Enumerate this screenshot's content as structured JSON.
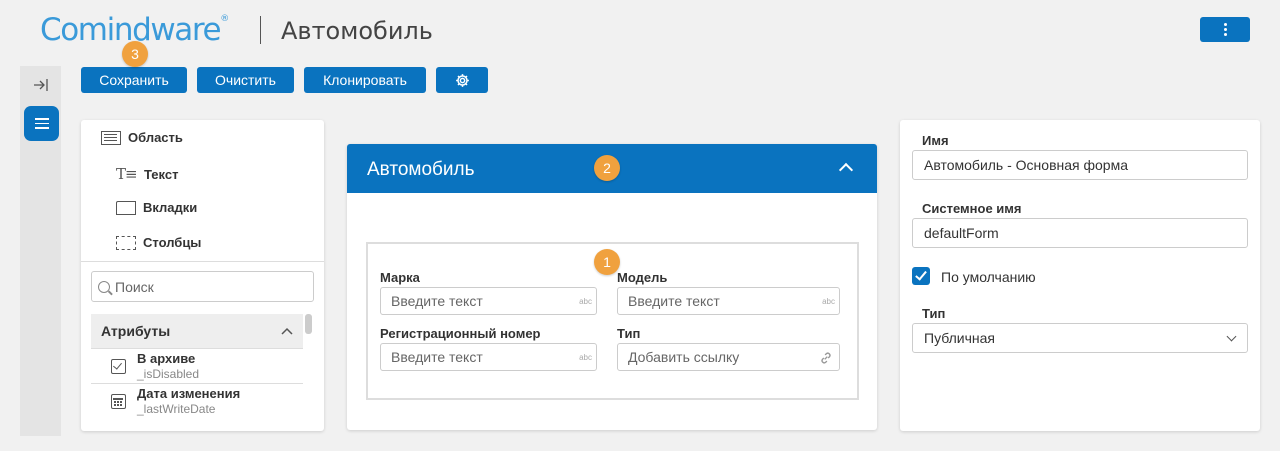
{
  "header": {
    "logo_main": "Comindware",
    "logo_trademark": "®",
    "page_title": "Автомобиль",
    "menu_icon": "more-vertical-icon"
  },
  "toolbar": {
    "save": "Сохранить",
    "clear": "Очистить",
    "clone": "Клонировать",
    "settings_icon": "gear-icon"
  },
  "badges": {
    "form_fields": "1",
    "form_header": "2",
    "save": "3"
  },
  "rail": {
    "collapse_icon": "collapse-right-icon",
    "menu_icon": "hamburger-icon"
  },
  "toolbox": {
    "items": [
      {
        "label": "Область",
        "icon": "area-icon"
      },
      {
        "label": "Текст",
        "icon": "text-icon"
      },
      {
        "label": "Вкладки",
        "icon": "tabs-icon"
      },
      {
        "label": "Столбцы",
        "icon": "columns-icon"
      }
    ],
    "search_placeholder": "Поиск",
    "attributes_header": "Атрибуты",
    "attributes": [
      {
        "name": "В архиве",
        "system_name": "_isDisabled",
        "icon": "checkbox-icon"
      },
      {
        "name": "Дата изменения",
        "system_name": "_lastWriteDate",
        "icon": "calendar-icon"
      }
    ]
  },
  "form": {
    "title": "Автомобиль",
    "fields": [
      {
        "label": "Марка",
        "placeholder": "Введите текст",
        "hint": "abc"
      },
      {
        "label": "Модель",
        "placeholder": "Введите текст",
        "hint": "abc"
      },
      {
        "label": "Регистрационный номер",
        "placeholder": "Введите текст",
        "hint": "abc"
      },
      {
        "label": "Тип",
        "placeholder": "Добавить ссылку",
        "hint": "link-icon"
      }
    ]
  },
  "properties": {
    "name_label": "Имя",
    "name_value": "Автомобиль - Основная форма",
    "system_name_label": "Системное имя",
    "system_name_value": "defaultForm",
    "default_label": "По умолчанию",
    "default_checked": true,
    "type_label": "Тип",
    "type_value": "Публичная"
  },
  "colors": {
    "primary": "#0a73bf",
    "badge": "#f0a13e",
    "background": "#f1f1f1"
  }
}
